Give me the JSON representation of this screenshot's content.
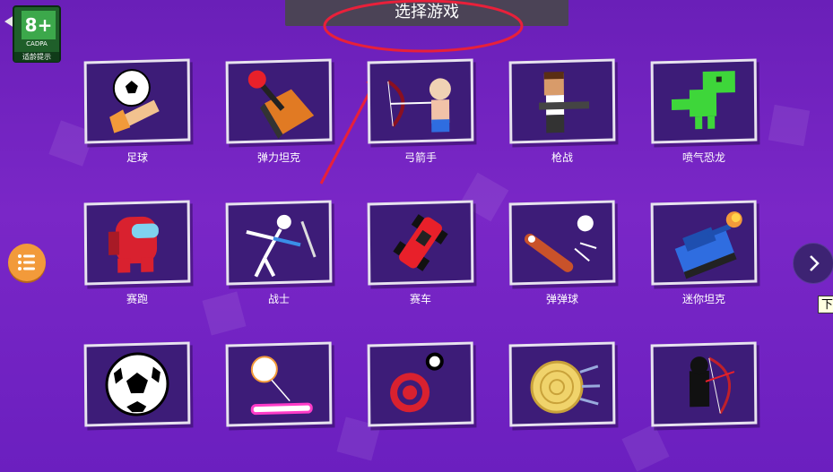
{
  "header": {
    "title": "选择游戏"
  },
  "age_rating": {
    "value": "8+",
    "org": "CADPA",
    "tip": "适龄提示"
  },
  "tooltip": {
    "text": "下"
  },
  "games": [
    {
      "label": "足球",
      "icon": "soccer-kick-icon"
    },
    {
      "label": "弹力坦克",
      "icon": "joystick-tank-icon"
    },
    {
      "label": "弓箭手",
      "icon": "archer-icon"
    },
    {
      "label": "枪战",
      "icon": "gunman-icon"
    },
    {
      "label": "喷气恐龙",
      "icon": "dino-icon"
    },
    {
      "label": "赛跑",
      "icon": "crewmate-icon"
    },
    {
      "label": "战士",
      "icon": "stickman-warrior-icon"
    },
    {
      "label": "赛车",
      "icon": "race-car-icon"
    },
    {
      "label": "弹弹球",
      "icon": "pinball-icon"
    },
    {
      "label": "迷你坦克",
      "icon": "mini-tank-icon"
    },
    {
      "label": "",
      "icon": "soccer-ball-icon"
    },
    {
      "label": "",
      "icon": "bounce-ball-icon"
    },
    {
      "label": "",
      "icon": "target-icon"
    },
    {
      "label": "",
      "icon": "knife-wood-icon"
    },
    {
      "label": "",
      "icon": "dark-archer-icon"
    }
  ],
  "colors": {
    "background": "#7a27c7",
    "card": "#3d1c78",
    "menu": "#f29a3a"
  }
}
